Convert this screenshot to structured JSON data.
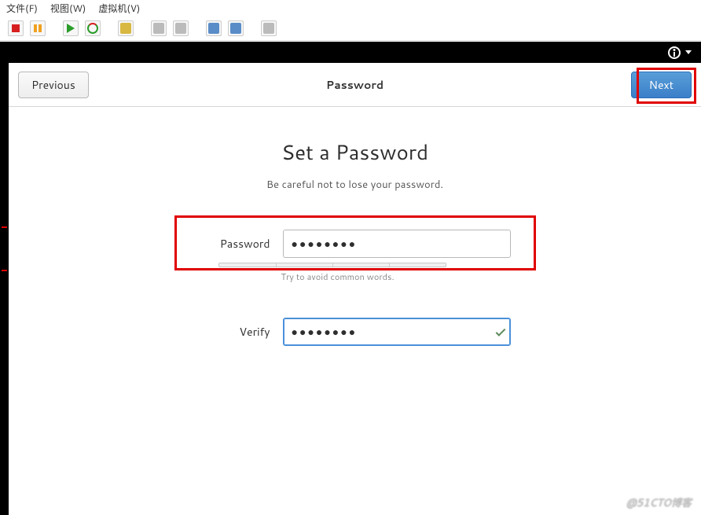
{
  "vmware": {
    "menu": {
      "file": "文件(F)",
      "view": "视图(W)",
      "vm": "虚拟机(V)"
    }
  },
  "gnome_topbar": {
    "accessibility_icon": "accessibility-icon"
  },
  "header": {
    "previous": "Previous",
    "title": "Password",
    "next": "Next"
  },
  "main": {
    "heading": "Set a Password",
    "subtitle": "Be careful not to lose your password."
  },
  "form": {
    "password_label": "Password",
    "password_value": "●●●●●●●●",
    "password_hint": "Try to avoid common words.",
    "verify_label": "Verify",
    "verify_value": "●●●●●●●●"
  },
  "watermark": "@51CTO博客"
}
